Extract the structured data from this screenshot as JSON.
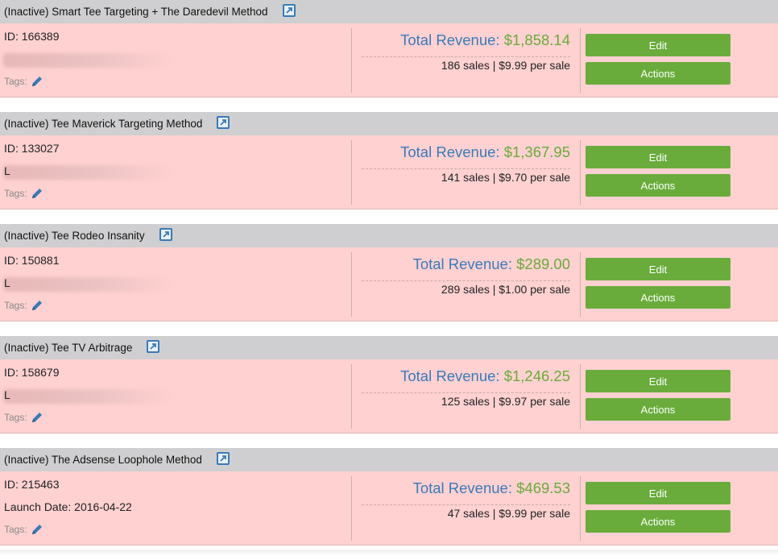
{
  "common": {
    "revenue_label": "Total Revenue: ",
    "tags_label": "Tags:",
    "edit_label": "Edit",
    "actions_label": "Actions"
  },
  "colors": {
    "header_bg": "#cfcfd1",
    "inactive_bg": "#ffd1d1",
    "revenue_label": "#3a7ab8",
    "revenue_amount": "#6aaa3a",
    "button": "#6aac3c"
  },
  "products": [
    {
      "title": "(Inactive) Smart Tee Targeting + The Daredevil Method",
      "id_text": "ID: 166389",
      "line2": "",
      "revenue": "$1,858.14",
      "sales": "186 sales | $9.99 per sale"
    },
    {
      "title": "(Inactive) Tee Maverick Targeting Method",
      "id_text": "ID: 133027",
      "line2": "L",
      "revenue": "$1,367.95",
      "sales": "141 sales | $9.70 per sale"
    },
    {
      "title": "(Inactive) Tee Rodeo Insanity",
      "id_text": "ID: 150881",
      "line2": "L",
      "revenue": "$289.00",
      "sales": "289 sales | $1.00 per sale"
    },
    {
      "title": "(Inactive) Tee TV Arbitrage",
      "id_text": "ID: 158679",
      "line2": "L",
      "revenue": "$1,246.25",
      "sales": "125 sales | $9.97 per sale"
    },
    {
      "title": "(Inactive) The Adsense Loophole Method",
      "id_text": "ID: 215463",
      "line2": "Launch Date: 2016-04-22",
      "revenue": "$469.53",
      "sales": "47 sales | $9.99 per sale"
    }
  ]
}
